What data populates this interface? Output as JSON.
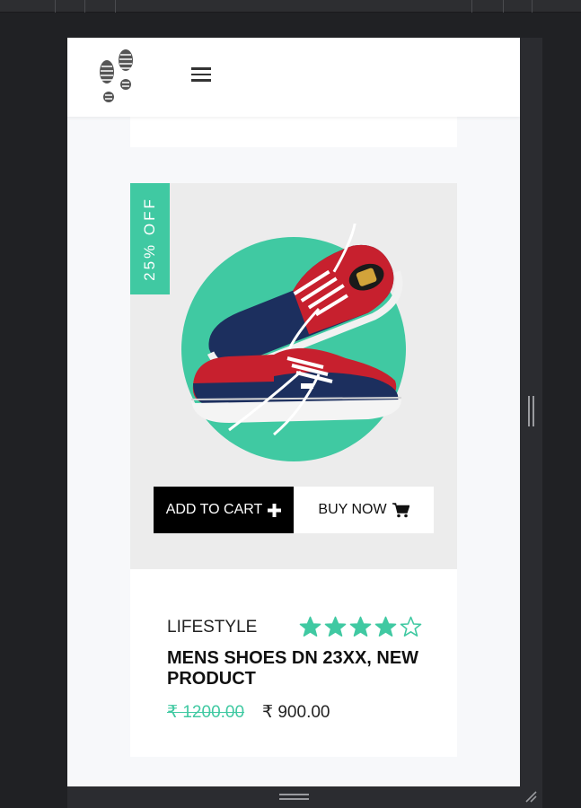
{
  "header": {
    "logo_icon": "footprints-icon",
    "menu_icon": "hamburger-menu-icon"
  },
  "product": {
    "discount": "25% OFF",
    "image": "red-and-navy-sneakers-on-green-circle",
    "add_to_cart_label": "ADD TO CART",
    "add_to_cart_icon": "plus-icon",
    "buy_now_label": "BUY NOW",
    "buy_now_icon": "shopping-cart-icon",
    "category": "LIFESTYLE",
    "rating": 4,
    "rating_max": 5,
    "title": "MENS SHOES DN 23XX, NEW PRODUCT",
    "original_price": "₹ 1200.00",
    "sale_price": "₹ 900.00"
  },
  "colors": {
    "accent": "#40c9a2",
    "button_dark": "#000000",
    "background": "#f7f8fa"
  }
}
